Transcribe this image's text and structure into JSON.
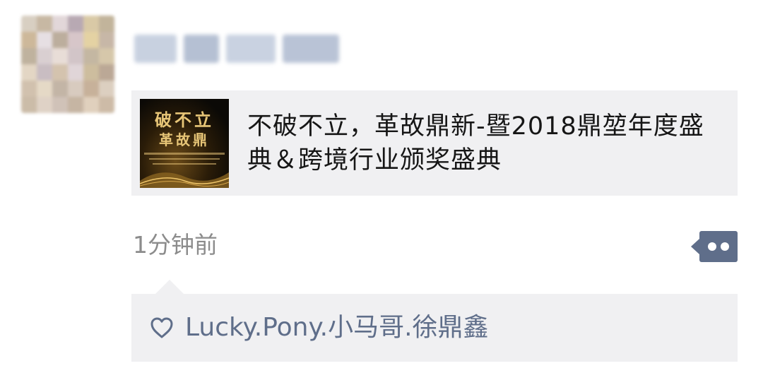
{
  "post": {
    "share_card": {
      "thumbnail_title_line1": "破不立",
      "thumbnail_title_line2": "革故鼎",
      "title": "不破不立，革故鼎新-暨2018鼎堃年度盛典＆跨境行业颁奖盛典"
    },
    "timestamp": "1分钟前",
    "more_icon": "more-dots-icon",
    "likes": {
      "icon": "heart-icon",
      "names": "Lucky.Pony.小马哥.徐鼎鑫"
    }
  },
  "colors": {
    "link_blue": "#5f6e8a",
    "card_bg": "#f0f0f2",
    "time_gray": "#8c8c8c"
  }
}
